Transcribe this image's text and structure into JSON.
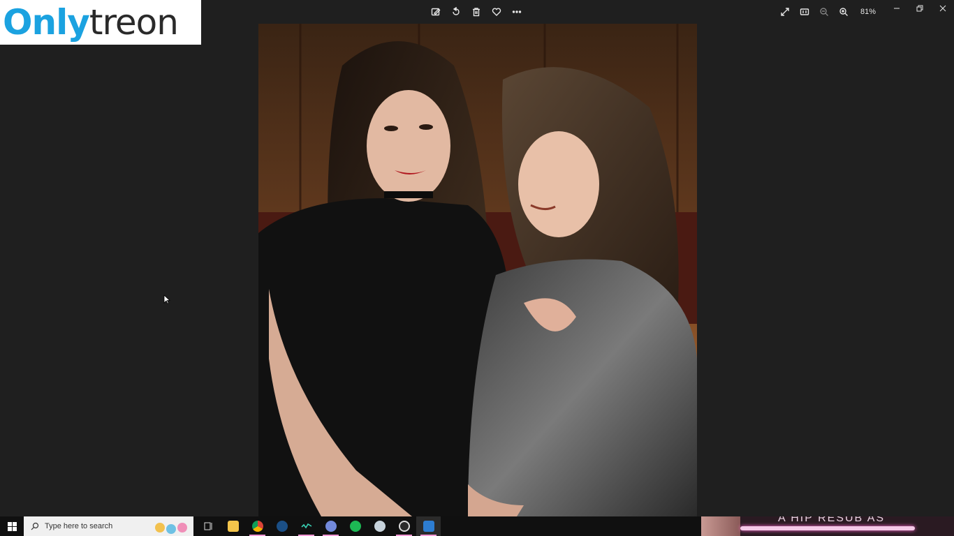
{
  "watermark": {
    "part1": "Only",
    "part2": "treon"
  },
  "toolbar": {
    "actions": [
      "edit-icon",
      "rotate-icon",
      "delete-icon",
      "favorite-icon",
      "more-icon"
    ],
    "view": {
      "zoom_label": "81%"
    }
  },
  "window_controls": [
    "minimize",
    "restore",
    "close"
  ],
  "taskbar": {
    "search_placeholder": "Type here to search",
    "apps": [
      "task-view",
      "file-explorer",
      "chrome",
      "steam",
      "app-wave",
      "discord",
      "spotify",
      "ccleaner",
      "obs",
      "photos"
    ],
    "stream_text": "A HIP RESUB AS"
  },
  "colors": {
    "background": "#1f1f1f",
    "taskbar": "#101010",
    "watermark_blue": "#1ba2e0",
    "accent_pink": "#ff9ad8"
  }
}
